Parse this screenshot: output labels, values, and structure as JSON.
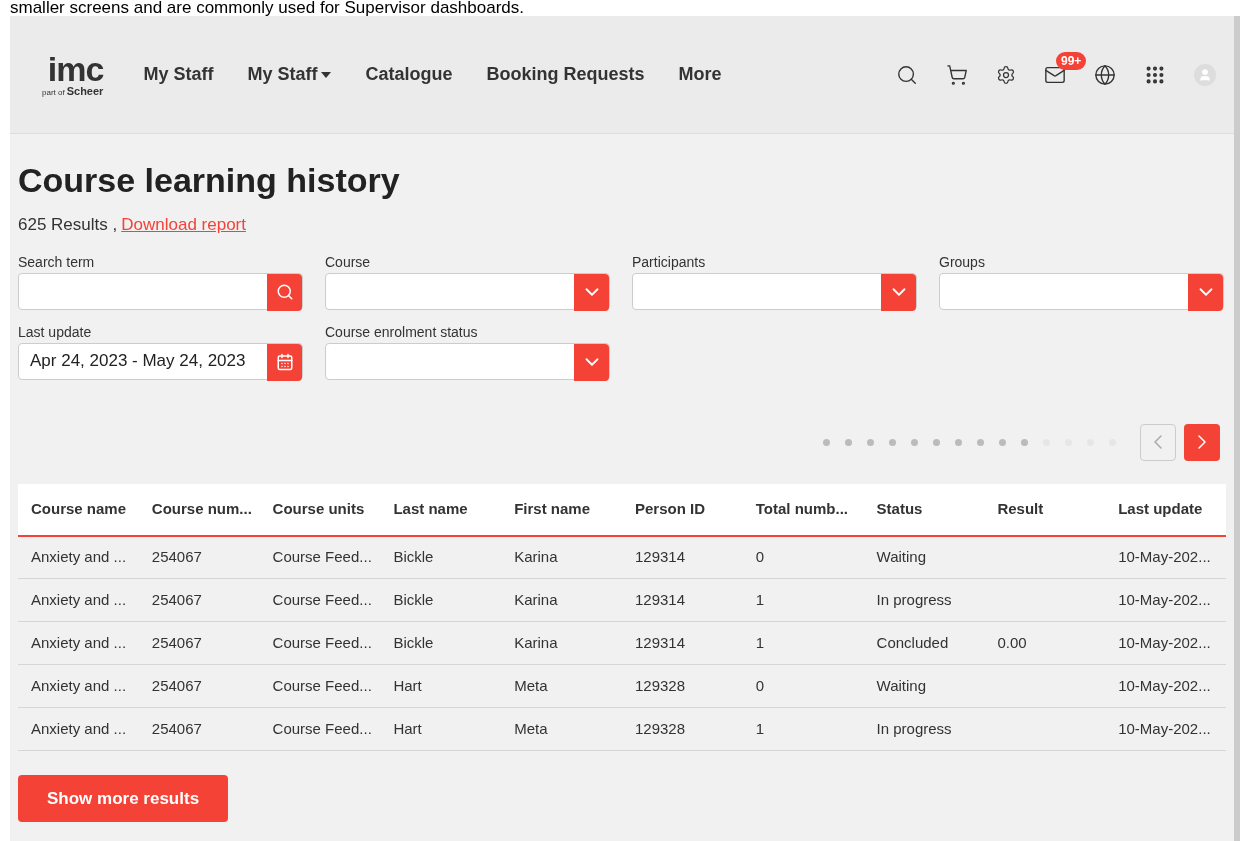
{
  "caption": "smaller screens and are commonly used for Supervisor dashboards.",
  "nav": {
    "logo": "imc",
    "logo_sub_small": "part of",
    "logo_sub": "Scheer",
    "items": [
      {
        "label": "My Staff",
        "dropdown": false
      },
      {
        "label": "My Staff",
        "dropdown": true
      },
      {
        "label": "Catalogue",
        "dropdown": false
      },
      {
        "label": "Booking Requests",
        "dropdown": false
      },
      {
        "label": "More",
        "dropdown": false
      }
    ],
    "message_badge": "99+"
  },
  "page": {
    "title": "Course learning history",
    "results": "625 Results ,",
    "download_link": "Download report"
  },
  "filters": [
    {
      "label": "Search term",
      "kind": "search"
    },
    {
      "label": "Course",
      "kind": "select"
    },
    {
      "label": "Participants",
      "kind": "select"
    },
    {
      "label": "Groups",
      "kind": "select"
    },
    {
      "label": "Last update",
      "kind": "date",
      "value": "Apr 24, 2023 - May 24, 2023"
    },
    {
      "label": "Course enrolment status",
      "kind": "select"
    }
  ],
  "pager": {
    "dots": [
      {
        "selected": true
      },
      {
        "selected": true
      },
      {
        "selected": true
      },
      {
        "selected": true
      },
      {
        "selected": true
      },
      {
        "selected": true
      },
      {
        "selected": true
      },
      {
        "selected": true
      },
      {
        "selected": true
      },
      {
        "selected": true
      },
      {
        "selected": false
      },
      {
        "selected": false
      },
      {
        "selected": false
      },
      {
        "selected": false
      }
    ],
    "prev_disabled": true,
    "next_disabled": false
  },
  "table": {
    "columns": [
      "Course name",
      "Course num...",
      "Course units",
      "Last name",
      "First name",
      "Person ID",
      "Total numb...",
      "Status",
      "Result",
      "Last update"
    ],
    "rows": [
      [
        "Anxiety and ...",
        "254067",
        "Course Feed...",
        "Bickle",
        "Karina",
        "129314",
        "0",
        "Waiting",
        "",
        "10-May-202..."
      ],
      [
        "Anxiety and ...",
        "254067",
        "Course Feed...",
        "Bickle",
        "Karina",
        "129314",
        "1",
        "In progress",
        "",
        "10-May-202..."
      ],
      [
        "Anxiety and ...",
        "254067",
        "Course Feed...",
        "Bickle",
        "Karina",
        "129314",
        "1",
        "Concluded",
        "0.00",
        "10-May-202..."
      ],
      [
        "Anxiety and ...",
        "254067",
        "Course Feed...",
        "Hart",
        "Meta",
        "129328",
        "0",
        "Waiting",
        "",
        "10-May-202..."
      ],
      [
        "Anxiety and ...",
        "254067",
        "Course Feed...",
        "Hart",
        "Meta",
        "129328",
        "1",
        "In progress",
        "",
        "10-May-202..."
      ]
    ]
  },
  "show_more": "Show more results"
}
